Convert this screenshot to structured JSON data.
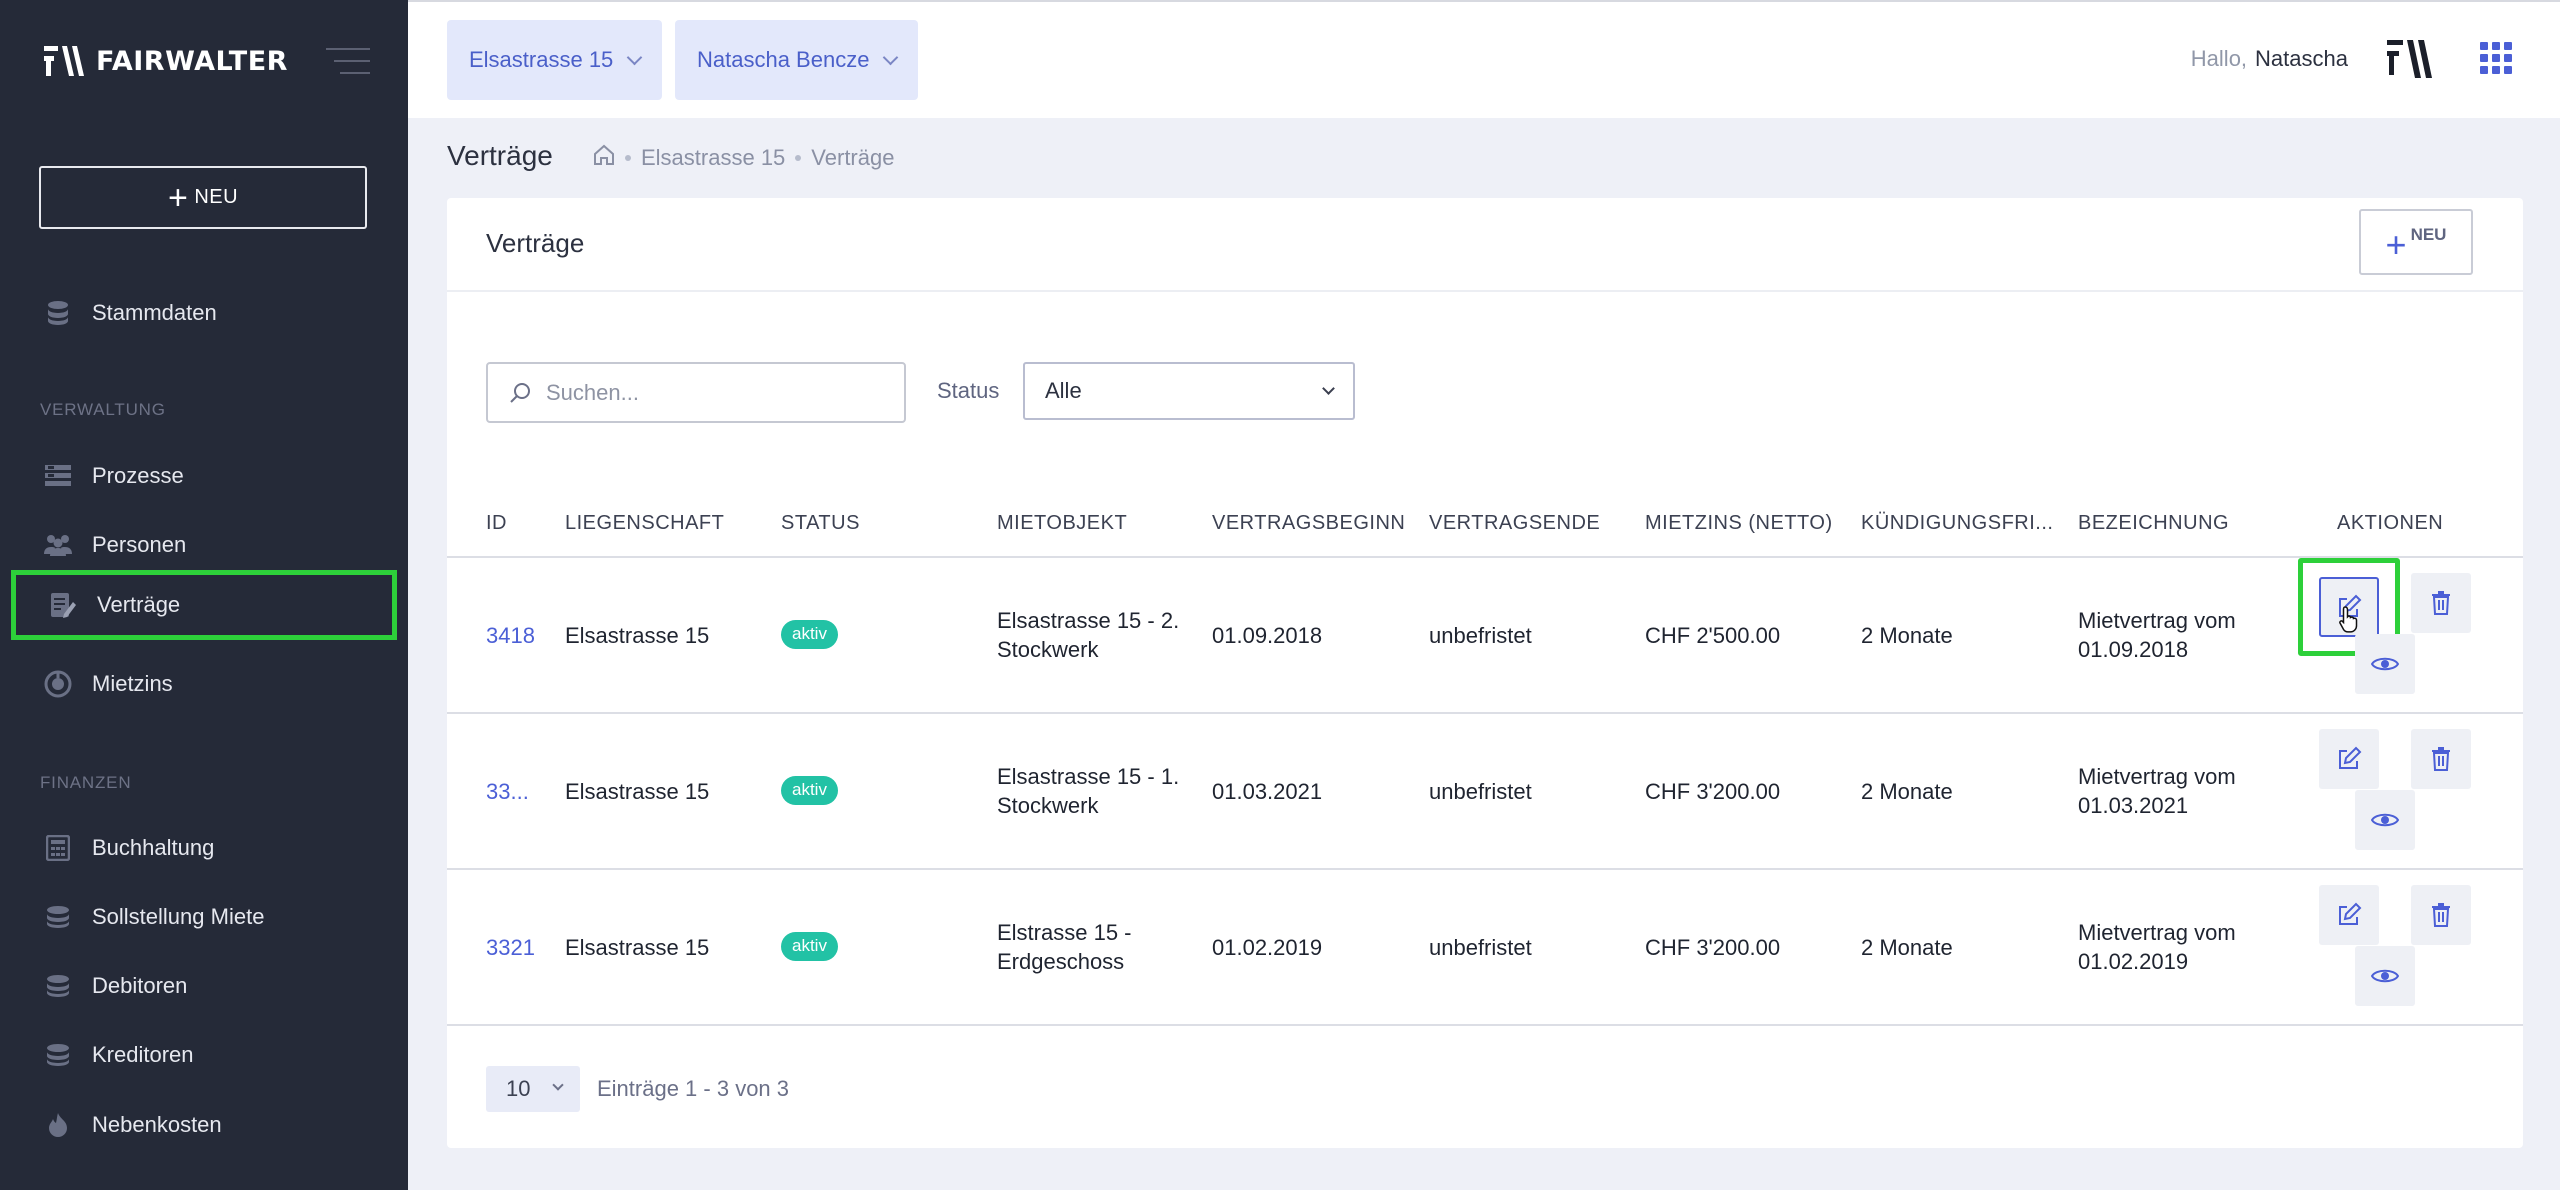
{
  "brand": {
    "name": "FAIRWALTER"
  },
  "sidebar": {
    "new_label": "NEU",
    "items_top": [
      {
        "label": "Stammdaten",
        "icon": "database-icon"
      }
    ],
    "section_verwaltung": "VERWALTUNG",
    "items_verwaltung": [
      {
        "label": "Prozesse",
        "icon": "process-icon"
      },
      {
        "label": "Personen",
        "icon": "people-icon"
      },
      {
        "label": "Verträge",
        "icon": "contract-icon",
        "active": true
      },
      {
        "label": "Mietzins",
        "icon": "rent-icon"
      }
    ],
    "section_finanzen": "FINANZEN",
    "items_finanzen": [
      {
        "label": "Buchhaltung",
        "icon": "calculator-icon"
      },
      {
        "label": "Sollstellung Miete",
        "icon": "coins-icon"
      },
      {
        "label": "Debitoren",
        "icon": "coins-icon"
      },
      {
        "label": "Kreditoren",
        "icon": "coins-icon"
      },
      {
        "label": "Nebenkosten",
        "icon": "flame-icon"
      }
    ]
  },
  "topbar": {
    "property_select": "Elsastrasse 15",
    "person_select": "Natascha Bencze",
    "greeting": "Hallo,",
    "user_name": "Natascha"
  },
  "breadcrumb": {
    "page_title": "Verträge",
    "items": [
      "Elsastrasse 15",
      "Verträge"
    ]
  },
  "card": {
    "title": "Verträge",
    "new_label": "NEU",
    "search_placeholder": "Suchen...",
    "status_label": "Status",
    "status_value": "Alle"
  },
  "table": {
    "headers": [
      "ID",
      "LIEGENSCHAFT",
      "STATUS",
      "MIETOBJEKT",
      "VERTRAGSBEGINN",
      "VERTRAGSENDE",
      "MIETZINS (NETTO)",
      "KÜNDIGUNGSFRI...",
      "BEZEICHNUNG",
      "AKTIONEN"
    ],
    "rows": [
      {
        "id": "3418",
        "property": "Elsastrasse 15",
        "status": "aktiv",
        "object_1": "Elsastrasse 15 - 2.",
        "object_2": "Stockwerk",
        "start": "01.09.2018",
        "end": "unbefristet",
        "rent": "CHF 2'500.00",
        "notice": "2 Monate",
        "desc_1": "Mietvertrag vom",
        "desc_2": "01.09.2018"
      },
      {
        "id": "33...",
        "property": "Elsastrasse 15",
        "status": "aktiv",
        "object_1": "Elsastrasse 15 - 1.",
        "object_2": "Stockwerk",
        "start": "01.03.2021",
        "end": "unbefristet",
        "rent": "CHF 3'200.00",
        "notice": "2 Monate",
        "desc_1": "Mietvertrag vom",
        "desc_2": "01.03.2021"
      },
      {
        "id": "3321",
        "property": "Elsastrasse 15",
        "status": "aktiv",
        "object_1": "Elstrasse 15 -",
        "object_2": "Erdgeschoss",
        "start": "01.02.2019",
        "end": "unbefristet",
        "rent": "CHF 3'200.00",
        "notice": "2 Monate",
        "desc_1": "Mietvertrag vom",
        "desc_2": "01.02.2019"
      }
    ]
  },
  "pagination": {
    "page_size": "10",
    "entries_text": "Einträge 1 - 3 von 3"
  },
  "colors": {
    "accent": "#4b5fd6",
    "sidebar": "#252a38",
    "badge": "#22c2a5",
    "highlight": "#2dd03a"
  }
}
